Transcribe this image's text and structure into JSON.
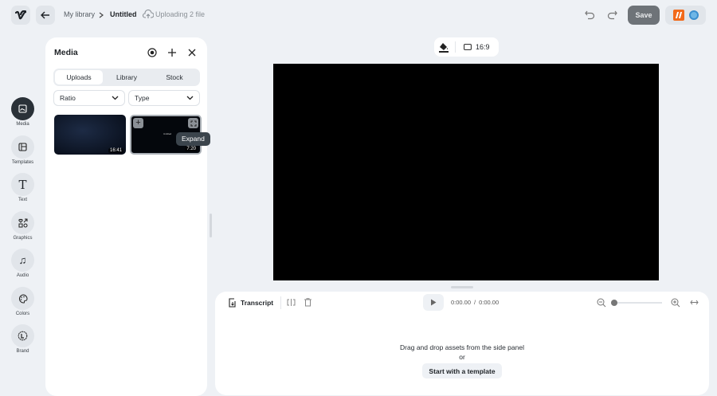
{
  "header": {
    "breadcrumb_root": "My library",
    "breadcrumb_current": "Untitled",
    "upload_status": "Uploading 2 file",
    "save_label": "Save"
  },
  "rail": [
    {
      "label": "Media",
      "icon": "image-icon"
    },
    {
      "label": "Templates",
      "icon": "layout-icon"
    },
    {
      "label": "Text",
      "icon": "text-icon"
    },
    {
      "label": "Graphics",
      "icon": "shapes-icon"
    },
    {
      "label": "Audio",
      "icon": "music-icon"
    },
    {
      "label": "Colors",
      "icon": "palette-icon"
    },
    {
      "label": "Brand",
      "icon": "brand-icon"
    }
  ],
  "media": {
    "title": "Media",
    "tabs": [
      "Uploads",
      "Library",
      "Stock"
    ],
    "active_tab": "Uploads",
    "ratio_label": "Ratio",
    "type_label": "Type",
    "items": [
      {
        "duration": "16:41"
      },
      {
        "duration": "7:20",
        "preview_text": "Untitled"
      }
    ],
    "tooltip": "Expand"
  },
  "canvas": {
    "aspect_ratio": "16:9"
  },
  "timeline": {
    "transcript_label": "Transcript",
    "current_time": "0:00.00",
    "separator": "/",
    "total_time": "0:00.00",
    "zoom_level": 0,
    "empty_text": "Drag and drop assets from the side panel",
    "or_text": "or",
    "template_button": "Start with a template"
  },
  "colors": {
    "accent_dark": "#2a3138",
    "save_bg": "#6e7378",
    "canvas_bg": "#000000",
    "brand_orange": "#f26a1b"
  }
}
